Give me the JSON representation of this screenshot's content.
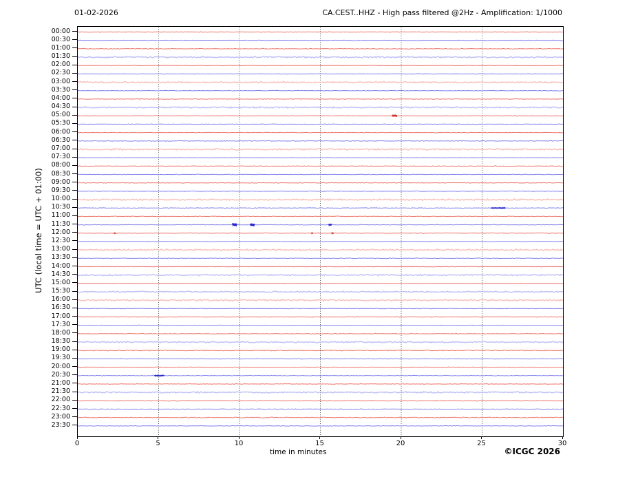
{
  "header": {
    "date": "01-02-2026",
    "title": "CA.CEST..HHZ - High pass filtered @2Hz - Amplification: 1/1000"
  },
  "axes": {
    "xlabel": "time in minutes",
    "ylabel": "UTC (local time = UTC + 01:00)"
  },
  "footer": {
    "credit": "©ICGC 2026"
  },
  "colors": {
    "trace_red": "#ec6e63",
    "trace_red_pale": "#f6b2aa",
    "trace_blue": "#7a7aea",
    "trace_blue_pale": "#b2b2f4",
    "event_red": "#d42a1e",
    "event_blue": "#2222cc",
    "grid": "#4a4a4a",
    "axis": "#000000",
    "background": "#ffffff"
  },
  "chart_data": {
    "type": "line",
    "subtype": "helicorder-daily-seismogram",
    "station": "CA.CEST..HHZ",
    "date": "01-02-2026",
    "filter": "High pass filtered @2Hz",
    "amplification": "1/1000",
    "x_range": [
      0,
      30
    ],
    "x_ticks": [
      0,
      5,
      10,
      15,
      20,
      25,
      30
    ],
    "x_grid_minutes": [
      5,
      10,
      15,
      20,
      25
    ],
    "grid_style": "vertical dotted gridlines every 5 minutes",
    "minutes_per_row": 30,
    "legend": "none",
    "rows": [
      {
        "label": "00:00",
        "color": "red",
        "amp": 0.5,
        "pale": false,
        "events": []
      },
      {
        "label": "00:30",
        "color": "blue",
        "amp": 0.5,
        "pale": false,
        "events": []
      },
      {
        "label": "01:00",
        "color": "red",
        "amp": 0.6,
        "pale": false,
        "events": []
      },
      {
        "label": "01:30",
        "color": "blue",
        "amp": 1.3,
        "pale": true,
        "events": []
      },
      {
        "label": "02:00",
        "color": "red",
        "amp": 0.5,
        "pale": false,
        "events": []
      },
      {
        "label": "02:30",
        "color": "blue",
        "amp": 0.5,
        "pale": false,
        "events": []
      },
      {
        "label": "03:00",
        "color": "red",
        "amp": 1.2,
        "pale": true,
        "events": []
      },
      {
        "label": "03:30",
        "color": "blue",
        "amp": 0.5,
        "pale": false,
        "events": []
      },
      {
        "label": "04:00",
        "color": "red",
        "amp": 0.5,
        "pale": false,
        "events": []
      },
      {
        "label": "04:30",
        "color": "blue",
        "amp": 1.2,
        "pale": true,
        "events": []
      },
      {
        "label": "05:00",
        "color": "red",
        "amp": 0.5,
        "pale": false,
        "events": [
          {
            "t": 19.6,
            "amp": 2.0,
            "w": 0.15
          }
        ]
      },
      {
        "label": "05:30",
        "color": "blue",
        "amp": 0.5,
        "pale": false,
        "events": []
      },
      {
        "label": "06:00",
        "color": "red",
        "amp": 0.5,
        "pale": false,
        "events": []
      },
      {
        "label": "06:30",
        "color": "blue",
        "amp": 0.6,
        "pale": false,
        "events": []
      },
      {
        "label": "07:00",
        "color": "red",
        "amp": 1.3,
        "pale": true,
        "events": []
      },
      {
        "label": "07:30",
        "color": "blue",
        "amp": 0.5,
        "pale": false,
        "events": []
      },
      {
        "label": "08:00",
        "color": "red",
        "amp": 0.5,
        "pale": false,
        "events": []
      },
      {
        "label": "08:30",
        "color": "blue",
        "amp": 0.5,
        "pale": false,
        "events": []
      },
      {
        "label": "09:00",
        "color": "red",
        "amp": 0.5,
        "pale": false,
        "events": []
      },
      {
        "label": "09:30",
        "color": "blue",
        "amp": 0.5,
        "pale": false,
        "events": []
      },
      {
        "label": "10:00",
        "color": "red",
        "amp": 1.3,
        "pale": true,
        "events": []
      },
      {
        "label": "10:30",
        "color": "blue",
        "amp": 0.5,
        "pale": false,
        "events": [
          {
            "t": 26.0,
            "amp": 0.8,
            "w": 0.45
          }
        ]
      },
      {
        "label": "11:00",
        "color": "red",
        "amp": 0.5,
        "pale": false,
        "events": []
      },
      {
        "label": "11:30",
        "color": "blue",
        "amp": 0.5,
        "pale": false,
        "events": [
          {
            "t": 9.7,
            "amp": 2.6,
            "w": 0.13
          },
          {
            "t": 10.8,
            "amp": 2.4,
            "w": 0.13
          },
          {
            "t": 15.6,
            "amp": 1.6,
            "w": 0.09
          }
        ]
      },
      {
        "label": "12:00",
        "color": "red",
        "amp": 0.5,
        "pale": false,
        "events": [
          {
            "t": 2.3,
            "amp": 0.7,
            "w": 0.06
          },
          {
            "t": 14.5,
            "amp": 0.8,
            "w": 0.06
          },
          {
            "t": 15.75,
            "amp": 1.1,
            "w": 0.07
          }
        ]
      },
      {
        "label": "12:30",
        "color": "blue",
        "amp": 0.5,
        "pale": false,
        "events": []
      },
      {
        "label": "13:00",
        "color": "red",
        "amp": 1.3,
        "pale": true,
        "events": []
      },
      {
        "label": "13:30",
        "color": "blue",
        "amp": 0.5,
        "pale": false,
        "events": []
      },
      {
        "label": "14:00",
        "color": "red",
        "amp": 0.5,
        "pale": false,
        "events": []
      },
      {
        "label": "14:30",
        "color": "blue",
        "amp": 1.2,
        "pale": true,
        "events": []
      },
      {
        "label": "15:00",
        "color": "red",
        "amp": 0.5,
        "pale": false,
        "events": []
      },
      {
        "label": "15:30",
        "color": "blue",
        "amp": 1.1,
        "pale": true,
        "events": []
      },
      {
        "label": "16:00",
        "color": "red",
        "amp": 1.3,
        "pale": true,
        "events": []
      },
      {
        "label": "16:30",
        "color": "blue",
        "amp": 0.5,
        "pale": false,
        "events": []
      },
      {
        "label": "17:00",
        "color": "red",
        "amp": 0.5,
        "pale": false,
        "events": []
      },
      {
        "label": "17:30",
        "color": "blue",
        "amp": 0.5,
        "pale": false,
        "events": []
      },
      {
        "label": "18:00",
        "color": "red",
        "amp": 0.5,
        "pale": false,
        "events": []
      },
      {
        "label": "18:30",
        "color": "blue",
        "amp": 1.2,
        "pale": true,
        "events": []
      },
      {
        "label": "19:00",
        "color": "red",
        "amp": 0.7,
        "pale": false,
        "events": []
      },
      {
        "label": "19:30",
        "color": "blue",
        "amp": 0.5,
        "pale": false,
        "events": []
      },
      {
        "label": "20:00",
        "color": "red",
        "amp": 0.5,
        "pale": false,
        "events": []
      },
      {
        "label": "20:30",
        "color": "blue",
        "amp": 0.5,
        "pale": false,
        "events": [
          {
            "t": 5.05,
            "amp": 0.9,
            "w": 0.3
          }
        ]
      },
      {
        "label": "21:00",
        "color": "red",
        "amp": 0.5,
        "pale": false,
        "events": []
      },
      {
        "label": "21:30",
        "color": "blue",
        "amp": 1.2,
        "pale": true,
        "events": []
      },
      {
        "label": "22:00",
        "color": "red",
        "amp": 0.7,
        "pale": false,
        "events": []
      },
      {
        "label": "22:30",
        "color": "blue",
        "amp": 0.5,
        "pale": false,
        "events": []
      },
      {
        "label": "23:00",
        "color": "red",
        "amp": 0.7,
        "pale": false,
        "events": []
      },
      {
        "label": "23:30",
        "color": "blue",
        "amp": 0.5,
        "pale": false,
        "events": []
      }
    ]
  }
}
